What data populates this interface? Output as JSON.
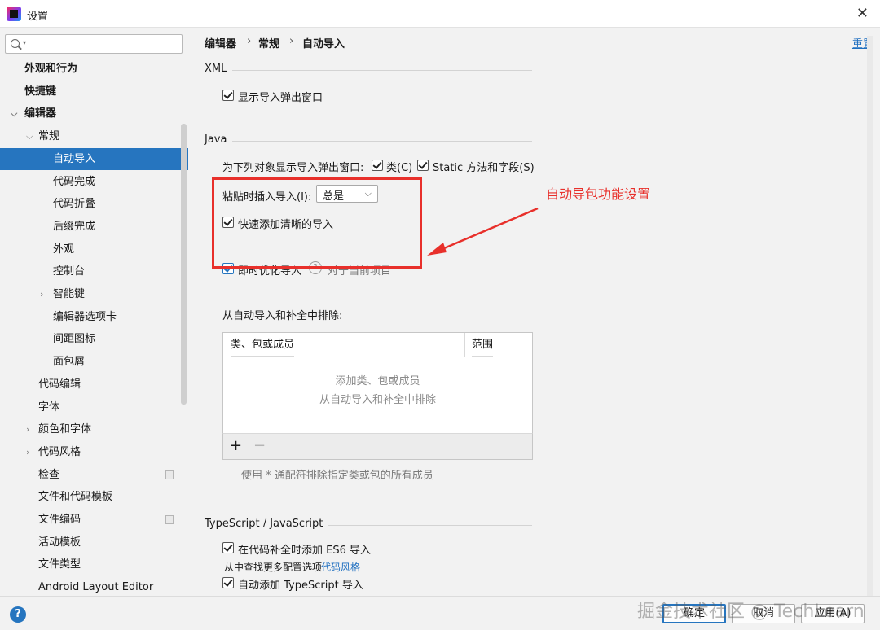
{
  "window": {
    "title": "设置"
  },
  "search": {
    "placeholder": ""
  },
  "sidebar": {
    "items": [
      {
        "label": "外观和行为",
        "level": 0,
        "bold": true,
        "arrow": "",
        "selected": false,
        "badge": false
      },
      {
        "label": "快捷键",
        "level": 0,
        "bold": true,
        "arrow": "",
        "selected": false,
        "badge": false
      },
      {
        "label": "编辑器",
        "level": 0,
        "bold": true,
        "arrow": "expanded",
        "selected": false,
        "badge": false
      },
      {
        "label": "常规",
        "level": 1,
        "bold": false,
        "arrow": "expanded",
        "selected": false,
        "badge": false
      },
      {
        "label": "自动导入",
        "level": 2,
        "bold": false,
        "arrow": "",
        "selected": true,
        "badge": false
      },
      {
        "label": "代码完成",
        "level": 2,
        "bold": false,
        "arrow": "",
        "selected": false,
        "badge": false
      },
      {
        "label": "代码折叠",
        "level": 2,
        "bold": false,
        "arrow": "",
        "selected": false,
        "badge": false
      },
      {
        "label": "后缀完成",
        "level": 2,
        "bold": false,
        "arrow": "",
        "selected": false,
        "badge": false
      },
      {
        "label": "外观",
        "level": 2,
        "bold": false,
        "arrow": "",
        "selected": false,
        "badge": false
      },
      {
        "label": "控制台",
        "level": 2,
        "bold": false,
        "arrow": "",
        "selected": false,
        "badge": false
      },
      {
        "label": "智能键",
        "level": 2,
        "bold": false,
        "arrow": "collapsed",
        "selected": false,
        "badge": false
      },
      {
        "label": "编辑器选项卡",
        "level": 2,
        "bold": false,
        "arrow": "",
        "selected": false,
        "badge": false
      },
      {
        "label": "间距图标",
        "level": 2,
        "bold": false,
        "arrow": "",
        "selected": false,
        "badge": false
      },
      {
        "label": "面包屑",
        "level": 2,
        "bold": false,
        "arrow": "",
        "selected": false,
        "badge": false
      },
      {
        "label": "代码编辑",
        "level": 1,
        "bold": false,
        "arrow": "",
        "selected": false,
        "badge": false
      },
      {
        "label": "字体",
        "level": 1,
        "bold": false,
        "arrow": "",
        "selected": false,
        "badge": false
      },
      {
        "label": "颜色和字体",
        "level": 1,
        "bold": false,
        "arrow": "collapsed",
        "selected": false,
        "badge": false
      },
      {
        "label": "代码风格",
        "level": 1,
        "bold": false,
        "arrow": "collapsed",
        "selected": false,
        "badge": false
      },
      {
        "label": "检查",
        "level": 1,
        "bold": false,
        "arrow": "",
        "selected": false,
        "badge": true
      },
      {
        "label": "文件和代码模板",
        "level": 1,
        "bold": false,
        "arrow": "",
        "selected": false,
        "badge": false
      },
      {
        "label": "文件编码",
        "level": 1,
        "bold": false,
        "arrow": "",
        "selected": false,
        "badge": true
      },
      {
        "label": "活动模板",
        "level": 1,
        "bold": false,
        "arrow": "",
        "selected": false,
        "badge": false
      },
      {
        "label": "文件类型",
        "level": 1,
        "bold": false,
        "arrow": "",
        "selected": false,
        "badge": false
      },
      {
        "label": "Android Layout Editor",
        "level": 1,
        "bold": false,
        "arrow": "",
        "selected": false,
        "badge": false
      }
    ]
  },
  "breadcrumb": {
    "a": "编辑器",
    "b": "常规",
    "c": "自动导入",
    "sep": "›"
  },
  "reset_label": "重置",
  "xml": {
    "title": "XML",
    "show_popup": "显示导入弹出窗口"
  },
  "java": {
    "title": "Java",
    "popup_prefix": "为下列对象显示导入弹出窗口:",
    "classes": "类(C)",
    "static": "Static 方法和字段(S)",
    "paste_label": "粘贴时插入导入(I):",
    "paste_value": "总是",
    "add_unambiguous": "快速添加清晰的导入",
    "optimize": "即时优化导入",
    "optimize_hint": "对于当前项目",
    "exclude_label": "从自动导入和补全中排除:",
    "table": {
      "col1": "类、包或成员",
      "col2": "范围",
      "empty1": "添加类、包或成员",
      "empty2": "从自动导入和补全中排除"
    },
    "add_btn": "+",
    "remove_btn": "−",
    "wildcard_hint": "使用 * 通配符排除指定类或包的所有成员"
  },
  "annotation": "自动导包功能设置",
  "ts": {
    "title": "TypeScript / JavaScript",
    "es6": "在代码补全时添加 ES6 导入",
    "more_prefix": "从中查找更多配置选项",
    "more_link": "代码风格",
    "auto_ts": "自动添加 TypeScript 导入"
  },
  "footer": {
    "help": "?",
    "ok": "确定",
    "cancel": "取消",
    "apply": "应用(A)",
    "watermark": "掘金技术社区 @ TechLearn"
  },
  "colors": {
    "accent": "#2675bf",
    "annotation": "#e8302b"
  }
}
